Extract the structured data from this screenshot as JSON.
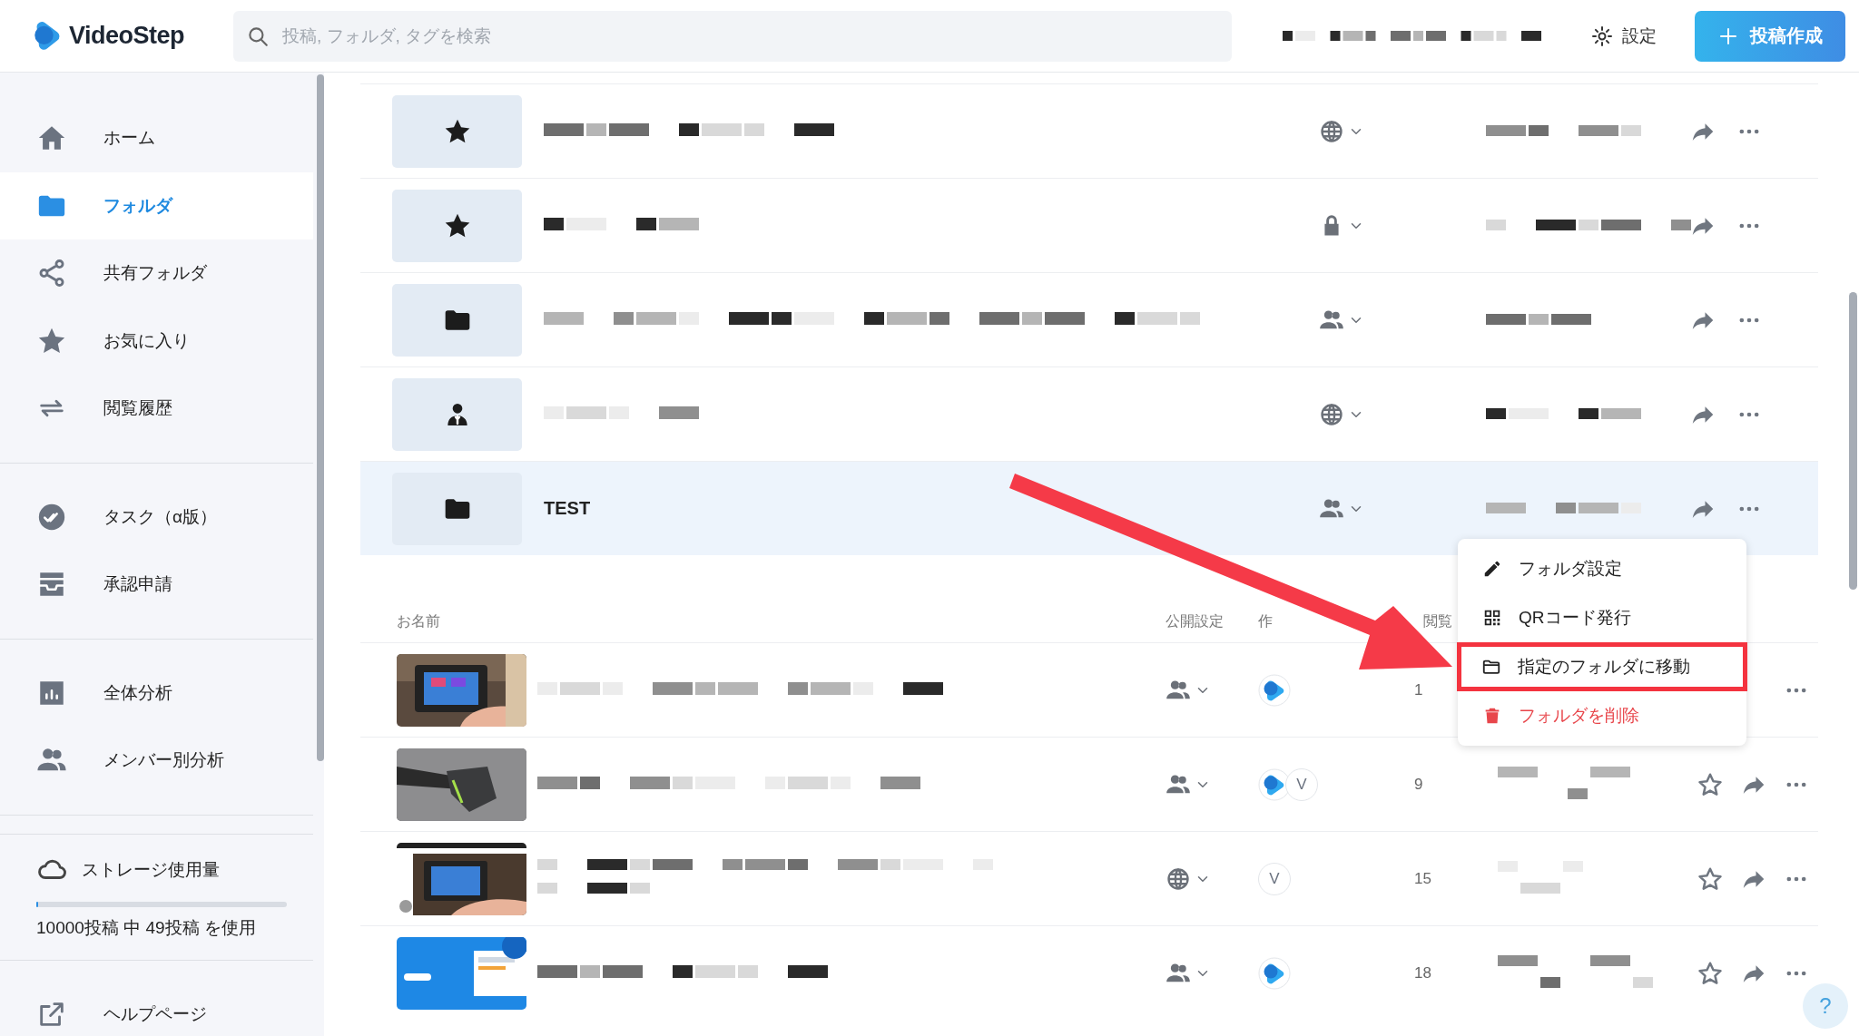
{
  "header": {
    "logo": "VideoStep",
    "search": {
      "placeholder": "投稿, フォルダ, タグを検索"
    },
    "settings": "設定",
    "create_button": "投稿作成"
  },
  "sidebar": {
    "groups": [
      {
        "items": [
          {
            "label": "ホーム",
            "selected": false
          },
          {
            "label": "フォルダ",
            "selected": true
          },
          {
            "label": "共有フォルダ",
            "selected": false
          },
          {
            "label": "お気に入り",
            "selected": false
          },
          {
            "label": "閲覧履歴",
            "selected": false
          }
        ]
      },
      {
        "items": [
          {
            "label": "タスク（α版）",
            "selected": false
          },
          {
            "label": "承認申請",
            "selected": false
          }
        ]
      },
      {
        "items": [
          {
            "label": "全体分析",
            "selected": false
          },
          {
            "label": "メンバー別分析",
            "selected": false
          }
        ]
      }
    ],
    "storage": {
      "title": "ストレージ使用量",
      "level": 0.005,
      "usage": "10000投稿 中 49投稿 を使用"
    },
    "help": "ヘルプページ"
  },
  "folders": [
    {
      "selected": false
    },
    {
      "selected": false
    },
    {
      "selected": false
    },
    {
      "selected": false
    },
    {
      "name": "TEST",
      "selected": true
    }
  ],
  "posts_table": {
    "columns": [
      "お名前",
      "公開設定",
      "作",
      "閲覧"
    ],
    "rows": [
      {
        "thumbnail": {
          "kind": "picture"
        },
        "creators": [
          {
            "kind": "logo"
          }
        ],
        "views": "1",
        "actions_visible": false
      },
      {
        "thumbnail": {
          "kind": "picture"
        },
        "creators": [
          {
            "kind": "logo"
          },
          {
            "kind": "letter",
            "text": "V"
          }
        ],
        "views": "9",
        "actions_visible": true
      },
      {
        "thumbnail": {
          "kind": "picture"
        },
        "creators": [
          {
            "kind": "letter",
            "text": "V"
          }
        ],
        "views": "15",
        "actions_visible": true
      },
      {
        "thumbnail": {
          "kind": "picture"
        },
        "creators": [
          {
            "kind": "logo"
          }
        ],
        "views": "18",
        "actions_visible": true
      }
    ]
  },
  "context_menu": {
    "items": [
      {
        "label": "フォルダ設定",
        "kind": "normal",
        "highlighted": false
      },
      {
        "label": "QRコード発行",
        "kind": "normal",
        "highlighted": false
      },
      {
        "label": "指定のフォルダに移動",
        "kind": "normal",
        "highlighted": true
      },
      {
        "label": "フォルダを削除",
        "kind": "danger",
        "highlighted": false
      }
    ]
  },
  "help_button": "?"
}
